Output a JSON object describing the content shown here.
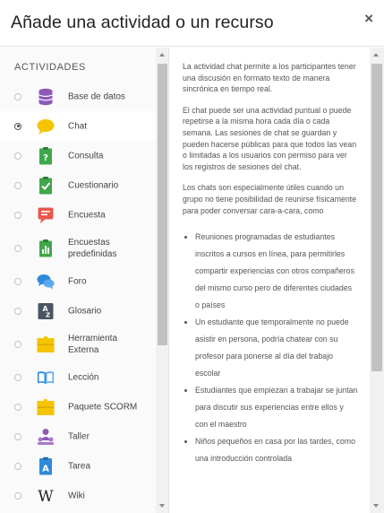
{
  "dialog": {
    "title": "Añade una actividad o un recurso",
    "close_label": "×"
  },
  "sidebar": {
    "section_title": "ACTIVIDADES",
    "items": [
      {
        "label": "Base de datos",
        "icon": "database-icon",
        "selected": false
      },
      {
        "label": "Chat",
        "icon": "chat-bubble-icon",
        "selected": true
      },
      {
        "label": "Consulta",
        "icon": "choice-question-icon",
        "selected": false
      },
      {
        "label": "Cuestionario",
        "icon": "quiz-check-icon",
        "selected": false
      },
      {
        "label": "Encuesta",
        "icon": "feedback-icon",
        "selected": false
      },
      {
        "label": "Encuestas predefinidas",
        "icon": "survey-chart-icon",
        "selected": false
      },
      {
        "label": "Foro",
        "icon": "forum-bubbles-icon",
        "selected": false
      },
      {
        "label": "Glosario",
        "icon": "glossary-az-icon",
        "selected": false
      },
      {
        "label": "Herramienta Externa",
        "icon": "external-tool-puzzle-icon",
        "selected": false
      },
      {
        "label": "Lección",
        "icon": "lesson-book-icon",
        "selected": false
      },
      {
        "label": "Paquete SCORM",
        "icon": "scorm-package-icon",
        "selected": false
      },
      {
        "label": "Taller",
        "icon": "workshop-people-icon",
        "selected": false
      },
      {
        "label": "Tarea",
        "icon": "assignment-icon",
        "selected": false
      },
      {
        "label": "Wiki",
        "icon": "wiki-w-icon",
        "selected": false
      }
    ]
  },
  "description": {
    "paragraphs": [
      "La actividad chat permite a los participantes tener una discusión en formato texto de manera sincrónica en tiempo real.",
      "El chat puede ser una actividad puntual o puede repetirse a la misma hora cada día o cada semana. Las sesiones de chat se guardan y pueden hacerse públicas para que todos las vean o limitadas a los usuarios con permiso para ver los registros de sesiones del chat.",
      "Los chats son especialmente útiles cuando un grupo no tiene posibilidad de reunirse físicamente para poder conversar cara-a-cara, como"
    ],
    "bullets": [
      "Reuniones programadas de estudiantes inscritos a cursos en línea, para permitirles compartir experiencias con otros compañeros del mismo curso pero de diferentes ciudades o países",
      "Un estudiante que temporalmente no puede asistir en persona, podría chatear con su profesor para ponerse al día del trabajo escolar",
      "Estudiantes que empiezan a trabajar se juntan para discutir sus experiencias entre ellos y con el maestro",
      "Niños pequeños en casa por las tardes, como una introducción controlada"
    ]
  }
}
